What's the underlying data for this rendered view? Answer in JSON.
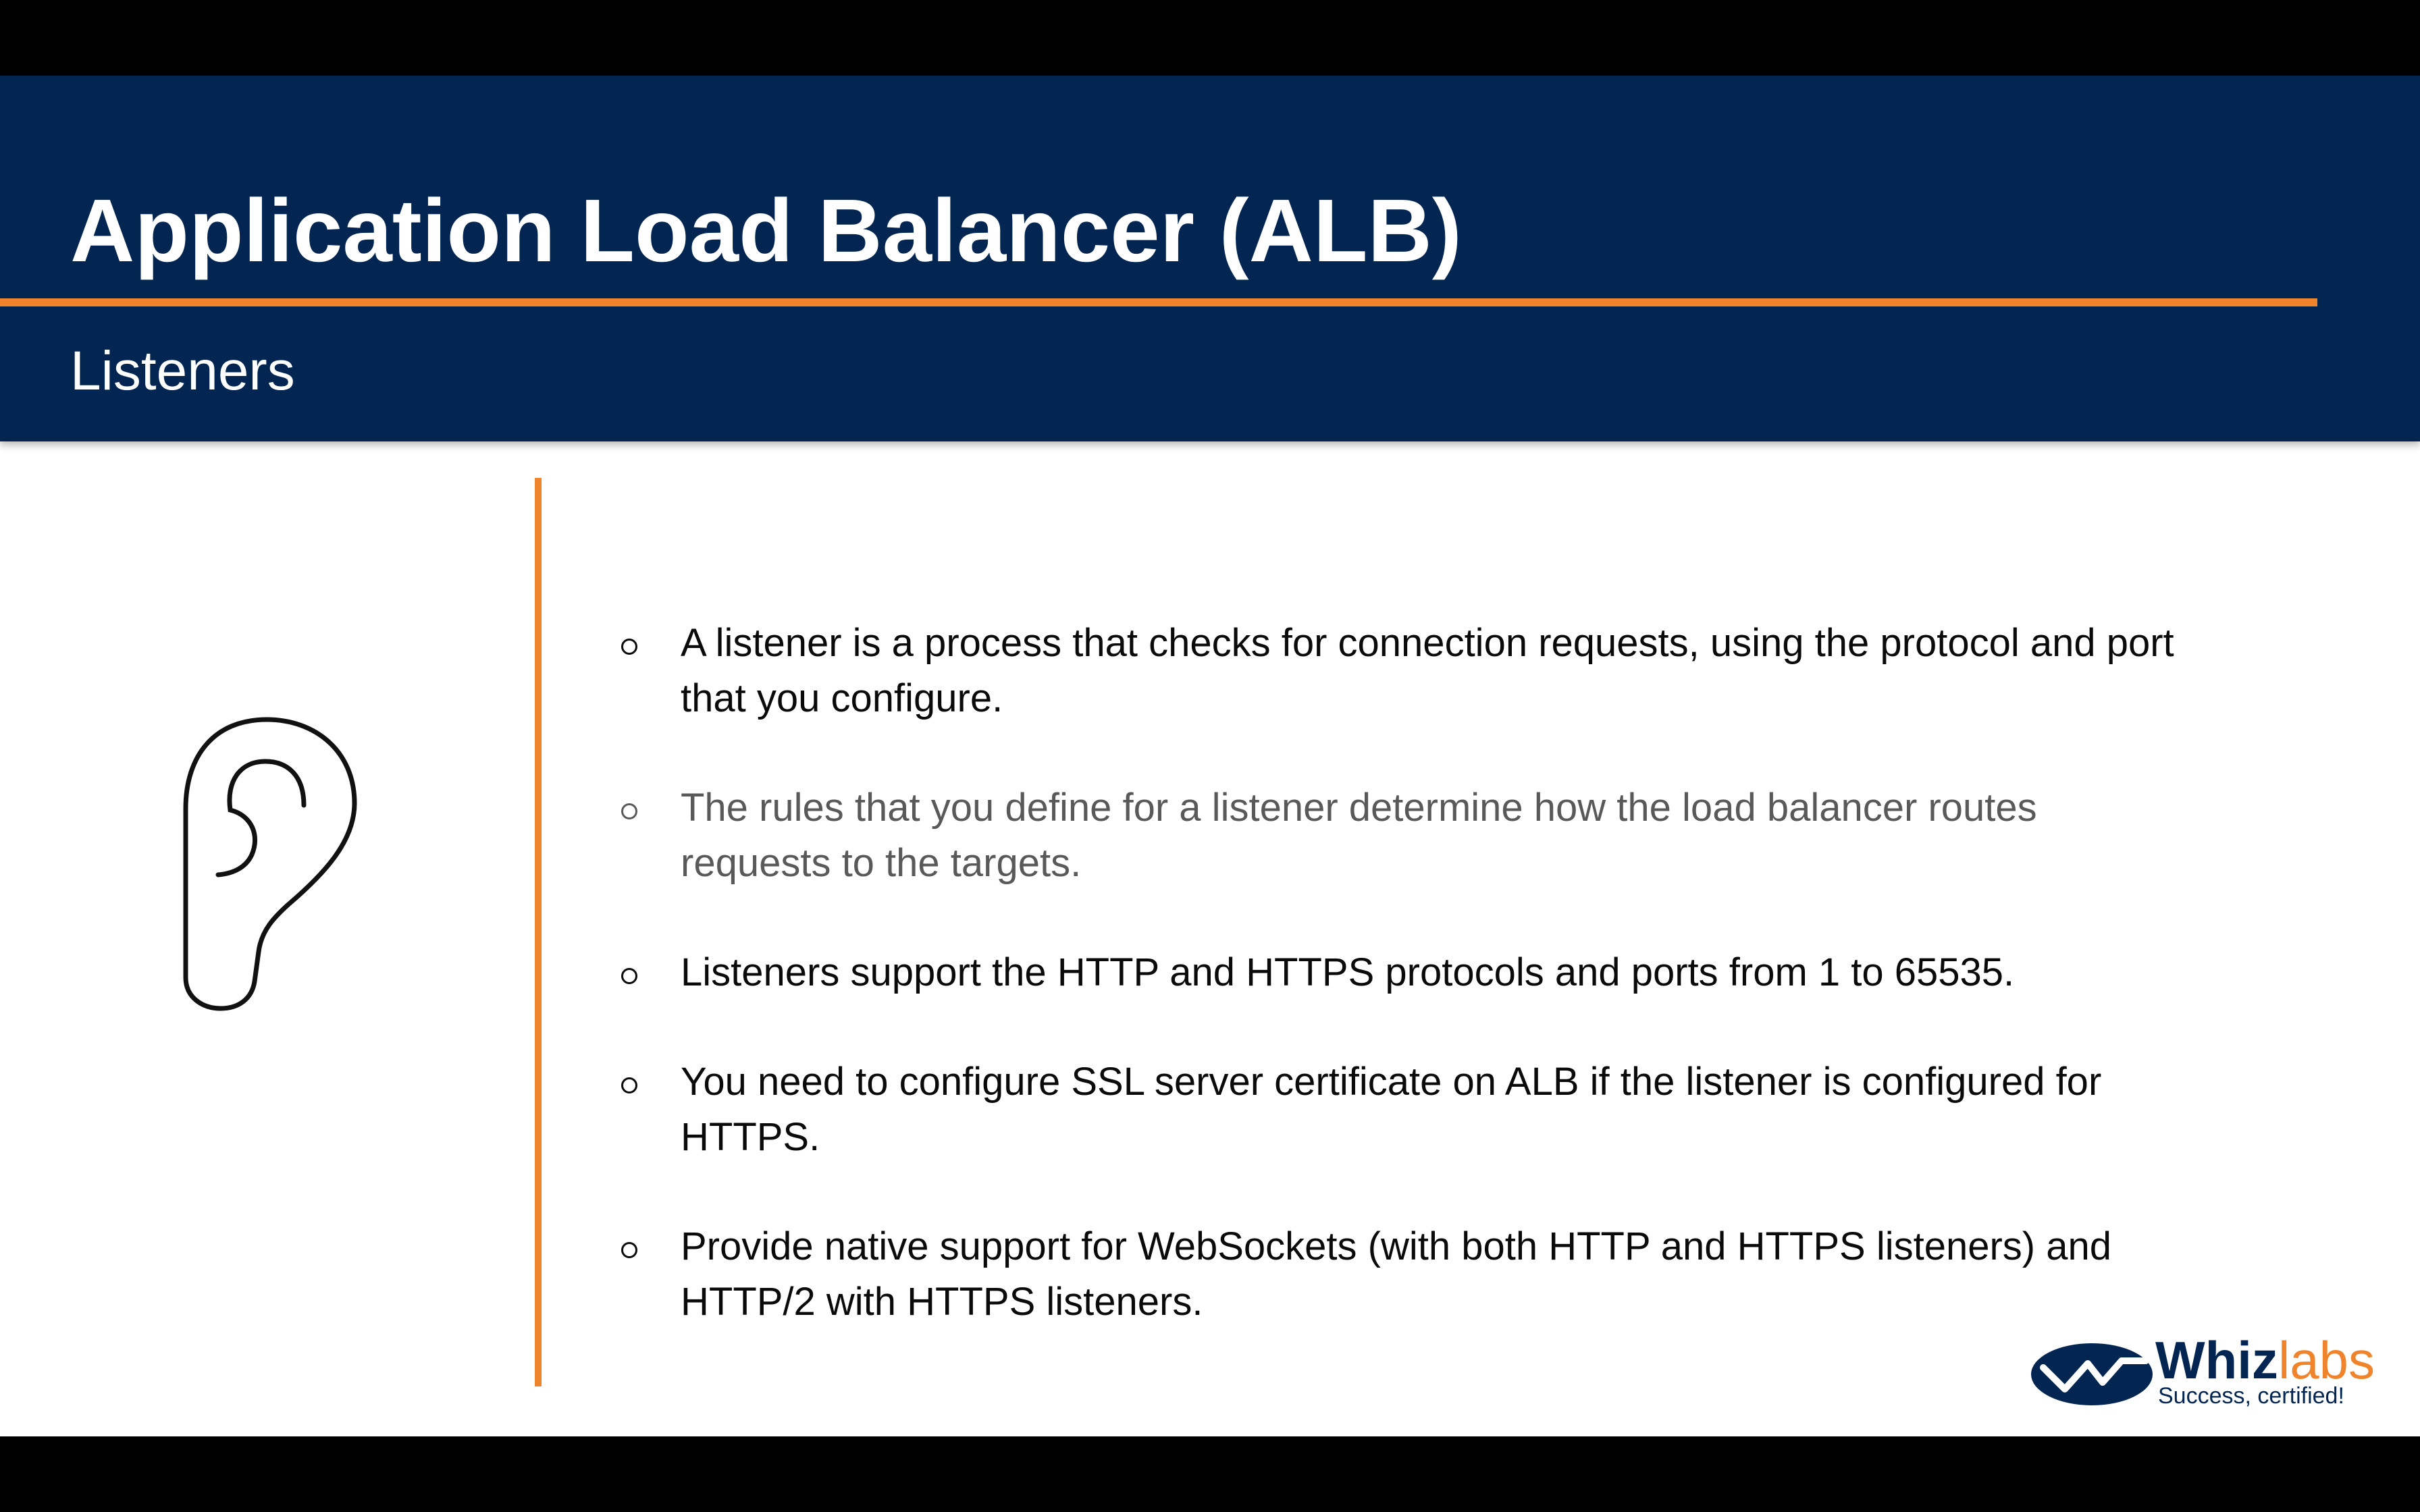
{
  "slide": {
    "title": "Application Load Balancer (ALB)",
    "subtitle": "Listeners",
    "accent_color": "#f0842c",
    "header_color": "#022651",
    "illustration_icon": "ear-icon",
    "bullets": [
      {
        "text": "A listener is a process that checks for connection requests, using the protocol and port that you configure."
      },
      {
        "text": "The rules that you define for a listener determine how the load balancer routes requests to the targets."
      },
      {
        "text": "Listeners support the HTTP and HTTPS protocols and ports from 1 to 65535."
      },
      {
        "text": "You need to configure SSL server certificate on ALB if the listener is configured for HTTPS."
      },
      {
        "text": "Provide native support for WebSockets (with both HTTP and HTTPS listeners) and HTTP/2 with HTTPS listeners."
      }
    ]
  },
  "logo": {
    "brand_primary": "Whiz",
    "brand_secondary": "labs",
    "tagline": "Success, certified!"
  }
}
